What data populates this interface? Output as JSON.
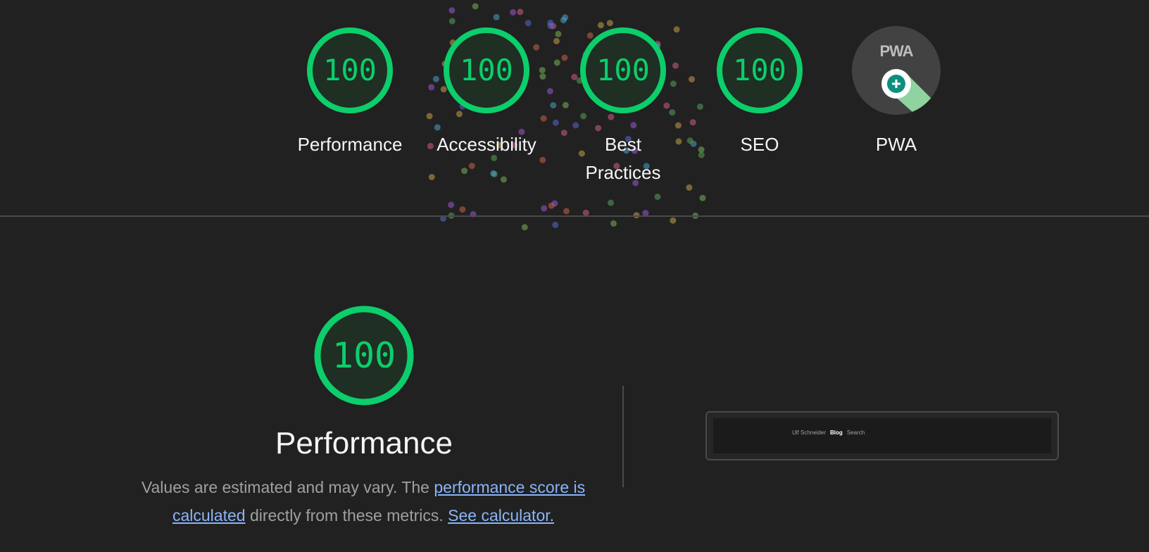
{
  "colors": {
    "background": "#212121",
    "pass_green": "#0cce6b",
    "gauge_fill": "#1f2f24",
    "link": "#8ab4f8",
    "muted_text": "#a0a0a0",
    "pwa_badge": "#424242",
    "pwa_teal": "#0d8f7e",
    "pwa_green_light": "#8fd4a0"
  },
  "categories": [
    {
      "id": "performance",
      "label": "Performance",
      "score": "100",
      "score_fraction": 1.0
    },
    {
      "id": "accessibility",
      "label": "Accessibility",
      "score": "100",
      "score_fraction": 1.0
    },
    {
      "id": "best-practices",
      "label": "Best Practices",
      "score": "100",
      "score_fraction": 1.0
    },
    {
      "id": "seo",
      "label": "SEO",
      "score": "100",
      "score_fraction": 1.0
    },
    {
      "id": "pwa",
      "label": "PWA",
      "badge_text": "PWA",
      "icon": "pwa-badge-icon"
    }
  ],
  "performance_section": {
    "score": "100",
    "score_fraction": 1.0,
    "title": "Performance",
    "description_text_1": "Values are estimated and may vary. The ",
    "description_link_1": "performance score is calculated",
    "description_text_2": " directly from these metrics. ",
    "description_link_2": "See calculator."
  },
  "screenshot_preview": {
    "nav_name": "Ulf Schneider",
    "nav_blog": "Blog",
    "nav_search": "Search"
  }
}
